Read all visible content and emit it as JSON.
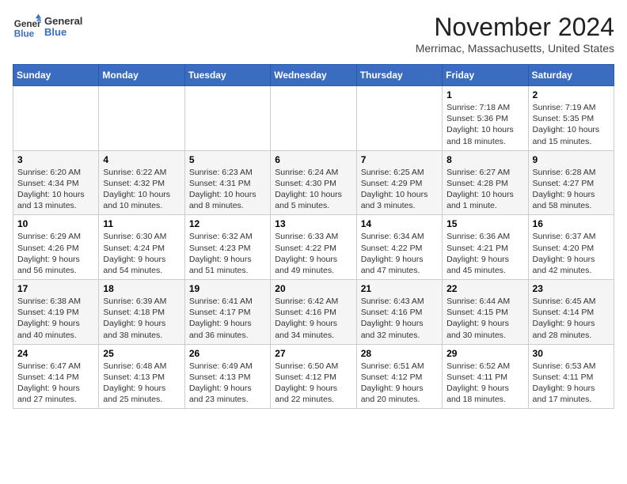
{
  "header": {
    "logo_line1": "General",
    "logo_line2": "Blue",
    "month_title": "November 2024",
    "location": "Merrimac, Massachusetts, United States"
  },
  "days_of_week": [
    "Sunday",
    "Monday",
    "Tuesday",
    "Wednesday",
    "Thursday",
    "Friday",
    "Saturday"
  ],
  "weeks": [
    [
      {
        "day": "",
        "info": ""
      },
      {
        "day": "",
        "info": ""
      },
      {
        "day": "",
        "info": ""
      },
      {
        "day": "",
        "info": ""
      },
      {
        "day": "",
        "info": ""
      },
      {
        "day": "1",
        "info": "Sunrise: 7:18 AM\nSunset: 5:36 PM\nDaylight: 10 hours and 18 minutes."
      },
      {
        "day": "2",
        "info": "Sunrise: 7:19 AM\nSunset: 5:35 PM\nDaylight: 10 hours and 15 minutes."
      }
    ],
    [
      {
        "day": "3",
        "info": "Sunrise: 6:20 AM\nSunset: 4:34 PM\nDaylight: 10 hours and 13 minutes."
      },
      {
        "day": "4",
        "info": "Sunrise: 6:22 AM\nSunset: 4:32 PM\nDaylight: 10 hours and 10 minutes."
      },
      {
        "day": "5",
        "info": "Sunrise: 6:23 AM\nSunset: 4:31 PM\nDaylight: 10 hours and 8 minutes."
      },
      {
        "day": "6",
        "info": "Sunrise: 6:24 AM\nSunset: 4:30 PM\nDaylight: 10 hours and 5 minutes."
      },
      {
        "day": "7",
        "info": "Sunrise: 6:25 AM\nSunset: 4:29 PM\nDaylight: 10 hours and 3 minutes."
      },
      {
        "day": "8",
        "info": "Sunrise: 6:27 AM\nSunset: 4:28 PM\nDaylight: 10 hours and 1 minute."
      },
      {
        "day": "9",
        "info": "Sunrise: 6:28 AM\nSunset: 4:27 PM\nDaylight: 9 hours and 58 minutes."
      }
    ],
    [
      {
        "day": "10",
        "info": "Sunrise: 6:29 AM\nSunset: 4:26 PM\nDaylight: 9 hours and 56 minutes."
      },
      {
        "day": "11",
        "info": "Sunrise: 6:30 AM\nSunset: 4:24 PM\nDaylight: 9 hours and 54 minutes."
      },
      {
        "day": "12",
        "info": "Sunrise: 6:32 AM\nSunset: 4:23 PM\nDaylight: 9 hours and 51 minutes."
      },
      {
        "day": "13",
        "info": "Sunrise: 6:33 AM\nSunset: 4:22 PM\nDaylight: 9 hours and 49 minutes."
      },
      {
        "day": "14",
        "info": "Sunrise: 6:34 AM\nSunset: 4:22 PM\nDaylight: 9 hours and 47 minutes."
      },
      {
        "day": "15",
        "info": "Sunrise: 6:36 AM\nSunset: 4:21 PM\nDaylight: 9 hours and 45 minutes."
      },
      {
        "day": "16",
        "info": "Sunrise: 6:37 AM\nSunset: 4:20 PM\nDaylight: 9 hours and 42 minutes."
      }
    ],
    [
      {
        "day": "17",
        "info": "Sunrise: 6:38 AM\nSunset: 4:19 PM\nDaylight: 9 hours and 40 minutes."
      },
      {
        "day": "18",
        "info": "Sunrise: 6:39 AM\nSunset: 4:18 PM\nDaylight: 9 hours and 38 minutes."
      },
      {
        "day": "19",
        "info": "Sunrise: 6:41 AM\nSunset: 4:17 PM\nDaylight: 9 hours and 36 minutes."
      },
      {
        "day": "20",
        "info": "Sunrise: 6:42 AM\nSunset: 4:16 PM\nDaylight: 9 hours and 34 minutes."
      },
      {
        "day": "21",
        "info": "Sunrise: 6:43 AM\nSunset: 4:16 PM\nDaylight: 9 hours and 32 minutes."
      },
      {
        "day": "22",
        "info": "Sunrise: 6:44 AM\nSunset: 4:15 PM\nDaylight: 9 hours and 30 minutes."
      },
      {
        "day": "23",
        "info": "Sunrise: 6:45 AM\nSunset: 4:14 PM\nDaylight: 9 hours and 28 minutes."
      }
    ],
    [
      {
        "day": "24",
        "info": "Sunrise: 6:47 AM\nSunset: 4:14 PM\nDaylight: 9 hours and 27 minutes."
      },
      {
        "day": "25",
        "info": "Sunrise: 6:48 AM\nSunset: 4:13 PM\nDaylight: 9 hours and 25 minutes."
      },
      {
        "day": "26",
        "info": "Sunrise: 6:49 AM\nSunset: 4:13 PM\nDaylight: 9 hours and 23 minutes."
      },
      {
        "day": "27",
        "info": "Sunrise: 6:50 AM\nSunset: 4:12 PM\nDaylight: 9 hours and 22 minutes."
      },
      {
        "day": "28",
        "info": "Sunrise: 6:51 AM\nSunset: 4:12 PM\nDaylight: 9 hours and 20 minutes."
      },
      {
        "day": "29",
        "info": "Sunrise: 6:52 AM\nSunset: 4:11 PM\nDaylight: 9 hours and 18 minutes."
      },
      {
        "day": "30",
        "info": "Sunrise: 6:53 AM\nSunset: 4:11 PM\nDaylight: 9 hours and 17 minutes."
      }
    ]
  ]
}
